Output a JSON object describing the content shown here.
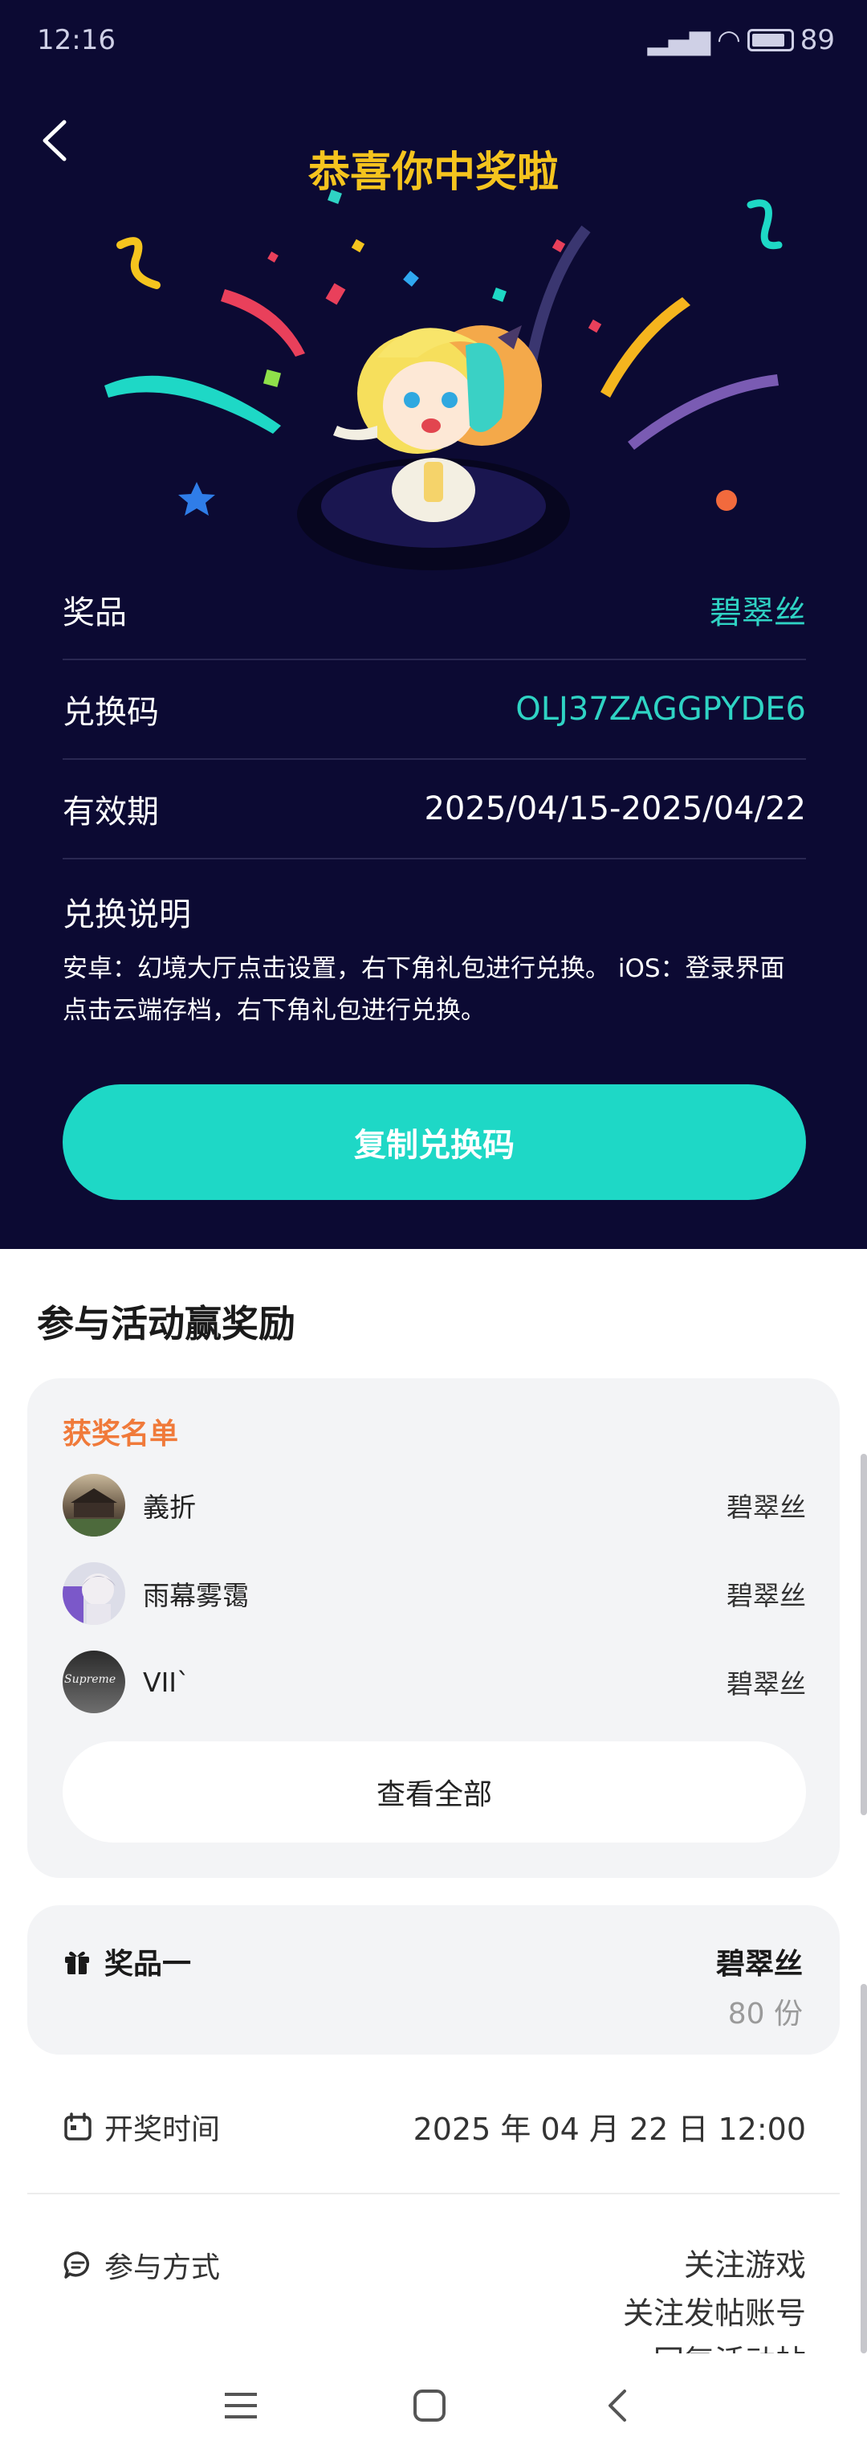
{
  "status": {
    "time": "12:16",
    "battery": "89"
  },
  "header": {
    "title": "恭喜你中奖啦"
  },
  "info": {
    "prize_label": "奖品",
    "prize_value": "碧翠丝",
    "code_label": "兑换码",
    "code_value": "OLJ37ZAGGPYDE6",
    "validity_label": "有效期",
    "validity_value": "2025/04/15-2025/04/22",
    "instructions_label": "兑换说明",
    "instructions_text": "安卓：幻境大厅点击设置，右下角礼包进行兑换。 iOS：登录界面点击云端存档，右下角礼包进行兑换。"
  },
  "copy_button": "复制兑换码",
  "activity": {
    "title": "参与活动赢奖励",
    "winners_title": "获奖名单",
    "winners": [
      {
        "name": "義折",
        "prize": "碧翠丝"
      },
      {
        "name": "雨幕雾霭",
        "prize": "碧翠丝"
      },
      {
        "name": "VII`",
        "prize": "碧翠丝"
      }
    ],
    "avatar_text": "Supreme",
    "view_all": "查看全部",
    "prize_label": "奖品一",
    "prize_name": "碧翠丝",
    "prize_count": "80 份",
    "draw_time_label": "开奖时间",
    "draw_time_value": "2025 年 04 月 22 日 12:00",
    "ways_label": "参与方式",
    "ways": [
      "关注游戏",
      "关注发帖账号",
      "回复活动帖"
    ]
  },
  "colors": {
    "hero_bg": "#0c0a33",
    "title_gold": "#f5c41e",
    "accent_teal": "#1ed8c6",
    "winners_orange": "#f07a3a"
  }
}
